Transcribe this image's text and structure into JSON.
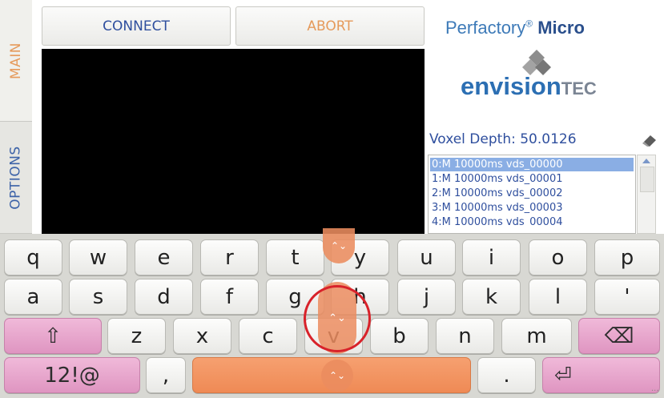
{
  "tabs": {
    "main": "MAIN",
    "options": "OPTIONS"
  },
  "toolbar": {
    "connect": "CONNECT",
    "abort": "ABORT"
  },
  "brand": {
    "perfactory": "Perfactory",
    "reg": "®",
    "micro": "Micro",
    "envision": "envision",
    "tec": "TEC"
  },
  "voxel": {
    "label": "Voxel Depth: 50.0126",
    "icon": "eraser-icon"
  },
  "layers": [
    "0:M 10000ms vds_00000",
    "1:M 10000ms vds_00001",
    "2:M 10000ms vds_00002",
    "3:M 10000ms vds_00003",
    "4:M 10000ms vds_00004"
  ],
  "keyboard": {
    "row1": [
      "q",
      "w",
      "e",
      "r",
      "t",
      "y",
      "u",
      "i",
      "o",
      "p"
    ],
    "row2": [
      "a",
      "s",
      "d",
      "f",
      "g",
      "h",
      "j",
      "k",
      "l",
      "'"
    ],
    "row3": [
      "z",
      "x",
      "c",
      "v",
      "b",
      "n",
      "m"
    ],
    "shift": "⇧",
    "backspace": "⌫",
    "symbols": "12!@",
    "comma": ",",
    "period": ".",
    "enter": "⏎",
    "handle_arrows": "⌃⌄",
    "more": "..."
  },
  "colors": {
    "accent_orange": "#e59a5b",
    "accent_blue": "#2f4f9e",
    "selection": "#8aaee4",
    "annotation_red": "#d8222a"
  }
}
